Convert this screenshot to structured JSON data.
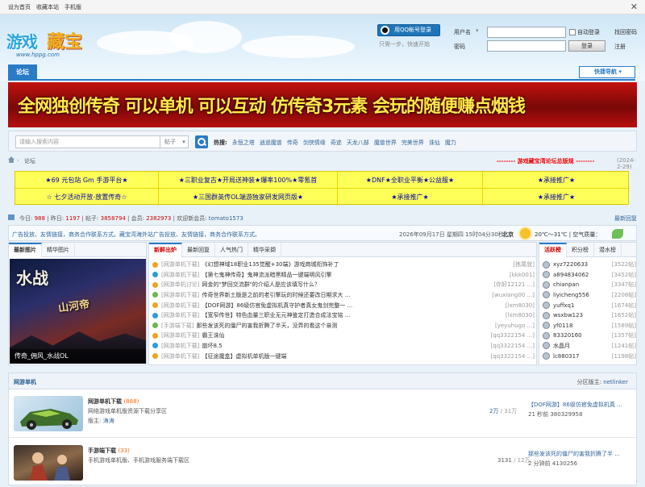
{
  "topbar": {
    "links": [
      "设为首页",
      "收藏本站",
      "手机版"
    ],
    "close": "✕"
  },
  "header": {
    "logo": {
      "part1": "游戏",
      "part2": "藏宝",
      "url": "www.hppg.com"
    },
    "qq_login": "用QQ帐号登录",
    "qq_hint": "只需一步，快速开始",
    "username_label": "用户名",
    "password_label": "密码",
    "auto_login": "自动登录",
    "forgot": "找回密码",
    "login_btn": "登录",
    "register": "注册"
  },
  "nav": {
    "tab": "论坛",
    "quick_nav": "快捷导航"
  },
  "banner": {
    "text": "全网独创传奇 可以单机 可以互动 仿传奇3元素 会玩的随便赚点烟钱"
  },
  "search": {
    "placeholder": "请输入搜索内容",
    "type": "帖子",
    "hot_label": "热搜:",
    "hot_words": [
      "永恒之塔",
      "逍遥魔兽",
      "传奇",
      "剑侠情缘",
      "奇迹",
      "天龙八部",
      "魔兽世界",
      "完美世界",
      "诛仙",
      "魔力"
    ]
  },
  "breadcrumb": {
    "current": "论坛",
    "red_notice": "-------- 游戏藏宝湾论坛总版规 --------",
    "date": "(2024-2-29)"
  },
  "ads": {
    "row1": [
      "★69 元包站 Gm 手游平台★",
      "★三职业复古★开局送神装★爆率100%★零氪首",
      "★DNF★全职业平衡★公益服★",
      "★承接推广★"
    ],
    "row2": [
      "☆ 七夕活动开放-放置传奇☆",
      "★三国群英传OL端游独家研发网页版★",
      "★承接推广★",
      "★承接推广★"
    ]
  },
  "stats": {
    "today_label": "今日:",
    "today": "988",
    "yesterday_label": "昨日:",
    "yesterday": "1197",
    "posts_label": "帖子:",
    "posts": "3858794",
    "members_label": "会员:",
    "members": "2382973",
    "welcome_label": "欢迎新会员:",
    "welcome": "tomato1573",
    "latest": "最新回复"
  },
  "notice": {
    "text": "广告投放、友情链接，商务合作联系方式。藏宝湾海外站广告投放、友情链接，商务合作联系方式。",
    "datetime": "2026年09月17日 星期四 15时04分30秒",
    "city": "北京",
    "weather": "20℃～31℃ | 空气质量："
  },
  "left_box": {
    "tabs": [
      "最新图片",
      "精华图片"
    ],
    "caption": "传奇_佣风_水战OL",
    "art1": "水战",
    "art2": "山河帝"
  },
  "mid_box": {
    "tabs": [
      "新鲜出炉",
      "最新回复",
      "人气热门",
      "精华采撷"
    ],
    "posts": [
      {
        "cat": "[网游单机下载]",
        "title": "《幻想神域18职业135觉醒+30端》游戏商城衔饰补丁",
        "author": "[拣尾就]"
      },
      {
        "cat": "[网游单机下载]",
        "title": "【第七鬼神传奇】鬼神流派暗黑精品一键端明风引擎",
        "author": "[kkk001]"
      },
      {
        "cat": "[网游单机讨论]",
        "title": "网金的\"梦回交流群\"的介绍人是应该填写什么？",
        "author": "[你好12121 ...]"
      },
      {
        "cat": "[网游单机下载]",
        "title": "传奇世界新土版是之前的老引擎玩的时候还要改日期求大 ...",
        "author": "[wuxiang00 ...]"
      },
      {
        "cat": "[网游单机下载]",
        "title": "【DOF网游】86级仿官免虚拟机真守护者真女鬼剑完整一 ...",
        "author": "[lxm8030]"
      },
      {
        "cat": "[网游单机下载]",
        "title": "【宽窄传世】特色血量三职业无元神鉴定打造合成法宝铭 ...",
        "author": "[lxm8030]"
      },
      {
        "cat": "[手游端下载]",
        "title": "那些发该死的僵尸的害我折腾了半天，没弄的看这个亲测",
        "author": "[yeyuhugo ...]"
      },
      {
        "cat": "[网游单机下载]",
        "title": "霸王诛仙",
        "author": "[qq3322154 ...]"
      },
      {
        "cat": "[网游单机下载]",
        "title": "崩坏8.5",
        "author": "[qq3322154 ...]"
      },
      {
        "cat": "[网游单机下载]",
        "title": "【征途魔盒】虚拟机单机版一键端",
        "author": "[qq3322154 ...]"
      }
    ],
    "bullet_colors": [
      "#f0a020",
      "#2f9bd8",
      "#f0a020",
      "#6bb84c",
      "#f0a020",
      "#2f9bd8",
      "#6bb84c",
      "#f0a020",
      "#2f9bd8",
      "#f0a020"
    ]
  },
  "right_box": {
    "tabs": [
      "活跃榜",
      "积分榜",
      "潜水榜"
    ],
    "ranks": [
      {
        "name": "xyz7220633",
        "count": "[3522帖]"
      },
      {
        "name": "a894834062",
        "count": "[3452帖]"
      },
      {
        "name": "chianpan",
        "count": "[3347帖]"
      },
      {
        "name": "liyicheng556",
        "count": "[2208帖]"
      },
      {
        "name": "yuffxq1",
        "count": "[1674帖]"
      },
      {
        "name": "wsxbw123",
        "count": "[1652帖]"
      },
      {
        "name": "yf0118",
        "count": "[1589帖]"
      },
      {
        "name": "83320160",
        "count": "[1357帖]"
      },
      {
        "name": "水晶月",
        "count": "[1241帖]"
      },
      {
        "name": "lc880317",
        "count": "[1198帖]"
      }
    ]
  },
  "forum": {
    "title": "网游单机",
    "moderator_label": "分区版主:",
    "moderator": "netlinker",
    "rows": [
      {
        "name": "网游单机下载",
        "today": "(888)",
        "desc": "网络游戏单机版资源下载分享区",
        "mod_label": "版主:",
        "mod": "涛涛",
        "threads": "2万",
        "posts": "/ 31万",
        "last_title": "【DOF网游】86级仿官免虚拟机真 ...",
        "last_meta": "21 秒前 380329958"
      },
      {
        "name": "手游端下载",
        "today": "(33)",
        "desc": "手机游戏单机版、手机游戏服务端下载区",
        "mod_label": "",
        "mod": "",
        "threads": "3131",
        "posts": "/ 12万",
        "last_title": "那些发该死的僵尸的害我折腾了半 ...",
        "last_meta": "2 分钟前 4130256"
      }
    ]
  }
}
